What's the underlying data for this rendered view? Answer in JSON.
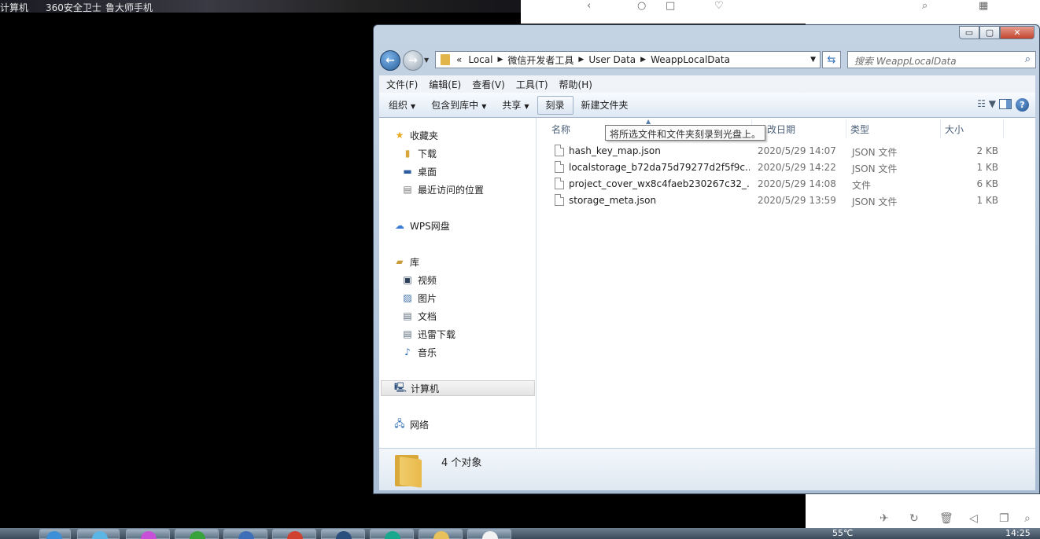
{
  "desktop": {
    "top_items": [
      "计算机",
      "360安全卫士",
      "鲁大师手机"
    ],
    "tray": {
      "temperature": "55℃",
      "time": "14:25"
    }
  },
  "window": {
    "controls": {
      "minimize": "▭",
      "maximize": "▢",
      "close": "✕"
    }
  },
  "address": {
    "prefix": "«",
    "crumbs": [
      "Local",
      "微信开发者工具",
      "User Data",
      "WeappLocalData"
    ],
    "search_placeholder": "搜索 WeappLocalData"
  },
  "menu": [
    "文件(F)",
    "编辑(E)",
    "查看(V)",
    "工具(T)",
    "帮助(H)"
  ],
  "commands": {
    "organize": "组织",
    "include_library": "包含到库中",
    "share": "共享",
    "burn": "刻录",
    "new_folder": "新建文件夹"
  },
  "tooltip": "将所选文件和文件夹刻录到光盘上。",
  "nav": {
    "favorites": "收藏夹",
    "downloads": "下载",
    "desktop": "桌面",
    "recent": "最近访问的位置",
    "wps": "WPS网盘",
    "libraries": "库",
    "videos": "视频",
    "pictures": "图片",
    "documents": "文档",
    "thunder": "迅雷下载",
    "music": "音乐",
    "computer": "计算机",
    "network": "网络"
  },
  "columns": {
    "name": "名称",
    "date": "改日期",
    "type": "类型",
    "size": "大小"
  },
  "files": [
    {
      "name": "hash_key_map.json",
      "date": "2020/5/29 14:07",
      "type": "JSON 文件",
      "size": "2 KB"
    },
    {
      "name": "localstorage_b72da75d79277d2f5f9c...",
      "date": "2020/5/29 14:22",
      "type": "JSON 文件",
      "size": "1 KB"
    },
    {
      "name": "project_cover_wx8c4faeb230267c32_...",
      "date": "2020/5/29 14:08",
      "type": "文件",
      "size": "6 KB"
    },
    {
      "name": "storage_meta.json",
      "date": "2020/5/29 13:59",
      "type": "JSON 文件",
      "size": "1 KB"
    }
  ],
  "details": {
    "count": "4 个对象"
  }
}
